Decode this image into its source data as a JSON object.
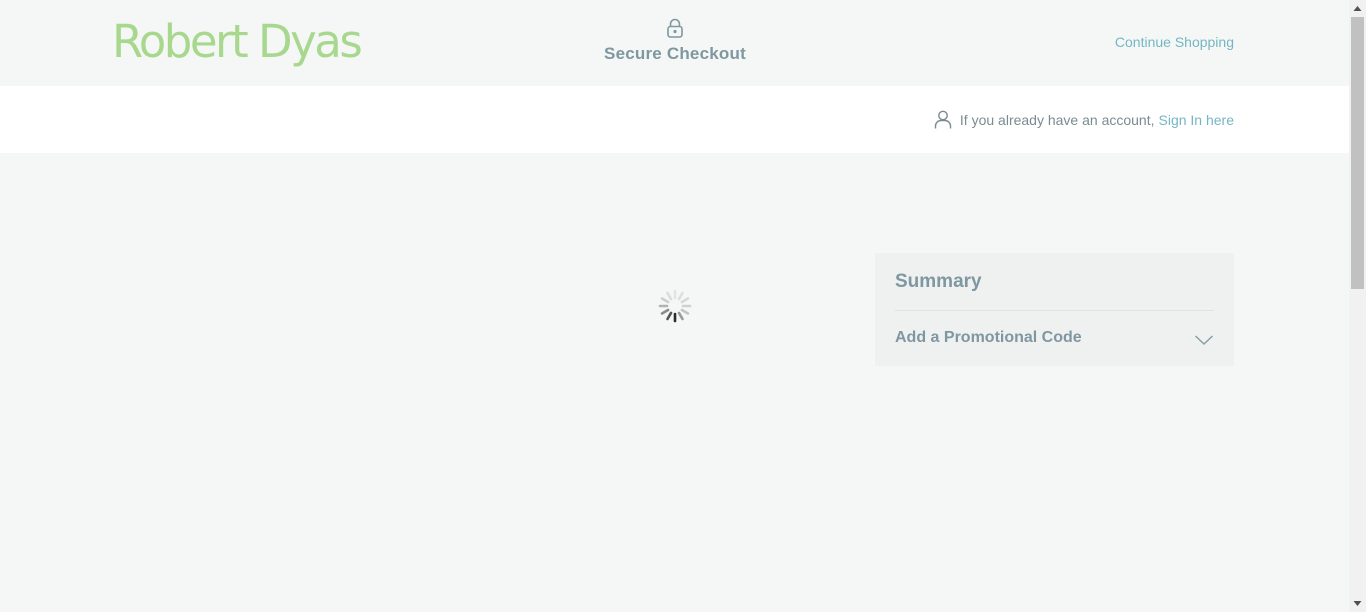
{
  "header": {
    "logo_text": "Robert Dyas",
    "secure_label": "Secure Checkout",
    "secure_icon": "lock-icon",
    "continue_label": "Continue Shopping"
  },
  "account": {
    "prompt": "If you already have an account,",
    "signin_label": "Sign In here",
    "icon": "user-icon"
  },
  "main": {
    "loading_icon": "spinner-icon"
  },
  "summary": {
    "title": "Summary",
    "promo_label": "Add a Promotional Code",
    "promo_icon": "chevron-down-icon"
  },
  "colors": {
    "brand_green": "#a8d88e",
    "accent_teal": "#74b7c2",
    "heading_gray": "#7f97a0",
    "page_bg": "#f5f7f6"
  }
}
